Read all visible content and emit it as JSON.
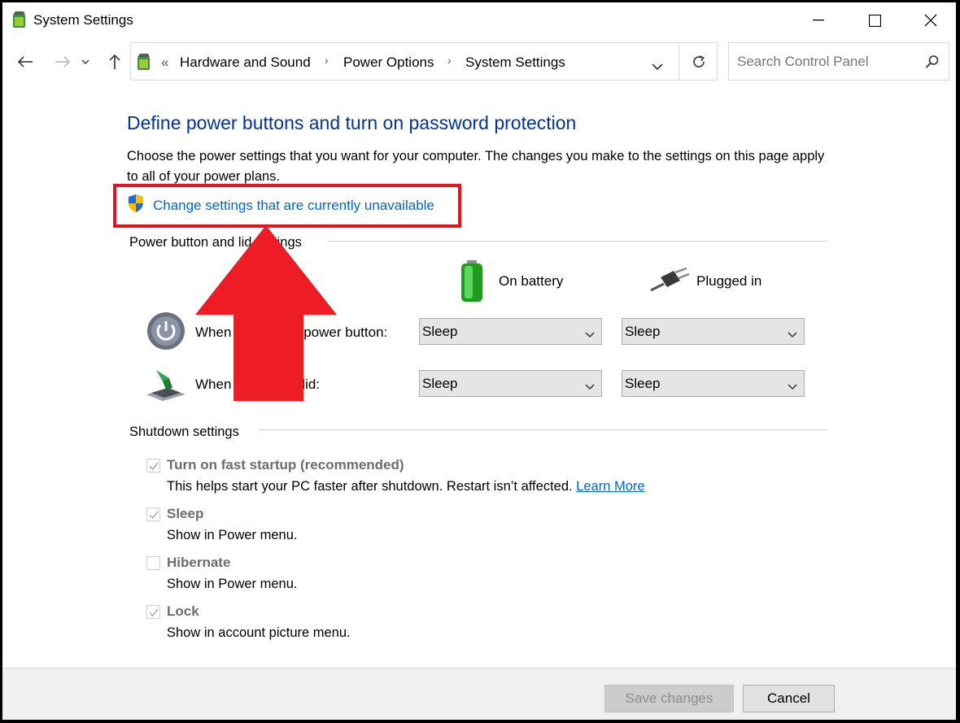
{
  "window": {
    "title": "System Settings"
  },
  "address": {
    "overflow": "«",
    "crumbs": [
      "Hardware and Sound",
      "Power Options",
      "System Settings"
    ]
  },
  "search": {
    "placeholder": "Search Control Panel"
  },
  "page": {
    "heading": "Define power buttons and turn on password protection",
    "description": "Choose the power settings that you want for your computer. The changes you make to the settings on this page apply to all of your power plans.",
    "change_link": "Change settings that are currently unavailable"
  },
  "power_group": {
    "label": "Power button and lid settings",
    "col_battery": "On battery",
    "col_plugged": "Plugged in",
    "rows": [
      {
        "label": "When I press the power button:",
        "battery": "Sleep",
        "plugged": "Sleep"
      },
      {
        "label": "When I close the lid:",
        "battery": "Sleep",
        "plugged": "Sleep"
      }
    ]
  },
  "shutdown_group": {
    "label": "Shutdown settings",
    "options": [
      {
        "title": "Turn on fast startup (recommended)",
        "desc": "This helps start your PC faster after shutdown. Restart isn’t affected. ",
        "link": "Learn More",
        "checked": true
      },
      {
        "title": "Sleep",
        "desc": "Show in Power menu.",
        "checked": true
      },
      {
        "title": "Hibernate",
        "desc": "Show in Power menu.",
        "checked": false
      },
      {
        "title": "Lock",
        "desc": "Show in account picture menu.",
        "checked": true
      }
    ]
  },
  "footer": {
    "save": "Save changes",
    "cancel": "Cancel"
  },
  "colors": {
    "heading": "#003399",
    "link": "#0066cc",
    "highlight_box": "#e3141e",
    "arrow": "#ee1c24"
  }
}
